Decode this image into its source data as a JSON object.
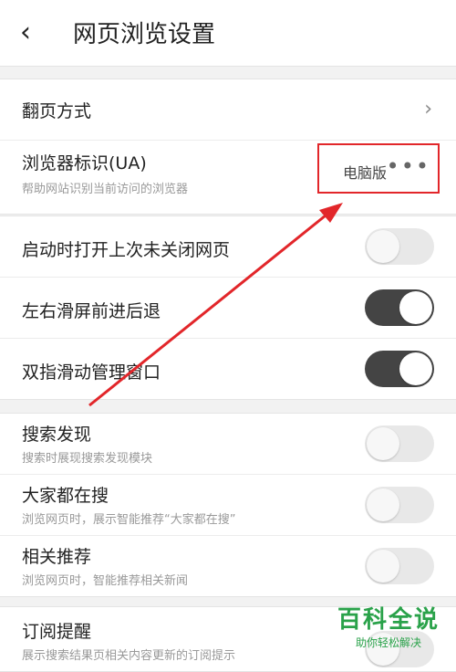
{
  "header": {
    "title": "网页浏览设置",
    "back_icon": "chevron-left-icon"
  },
  "section1": {
    "page_turn": {
      "label": "翻页方式"
    },
    "ua": {
      "label": "浏览器标识(UA)",
      "sub": "帮助网站识别当前访问的浏览器",
      "value": "电脑版",
      "more": "•••"
    }
  },
  "section2": {
    "restore_tabs": {
      "label": "启动时打开上次未关闭网页",
      "state": "off"
    },
    "swipe_nav": {
      "label": "左右滑屏前进后退",
      "state": "on"
    },
    "two_finger": {
      "label": "双指滑动管理窗口",
      "state": "on"
    }
  },
  "section3": {
    "search_discover": {
      "label": "搜索发现",
      "sub": "搜索时展现搜索发现模块",
      "state": "off"
    },
    "everyone_search": {
      "label": "大家都在搜",
      "sub": "浏览网页时，展示智能推荐“大家都在搜”",
      "state": "off"
    },
    "related": {
      "label": "相关推荐",
      "sub": "浏览网页时，智能推荐相关新闻",
      "state": "off"
    }
  },
  "section4": {
    "subscribe": {
      "label": "订阅提醒",
      "sub": "展示搜索结果页相关内容更新的订阅提示",
      "state": "off"
    }
  },
  "watermark": {
    "main": "百科全说",
    "sub": "助你轻松解决"
  },
  "colors": {
    "highlight": "#e2262a",
    "toggle_on": "#444444",
    "toggle_off": "#e8e8e8",
    "watermark": "#2aa24a"
  }
}
